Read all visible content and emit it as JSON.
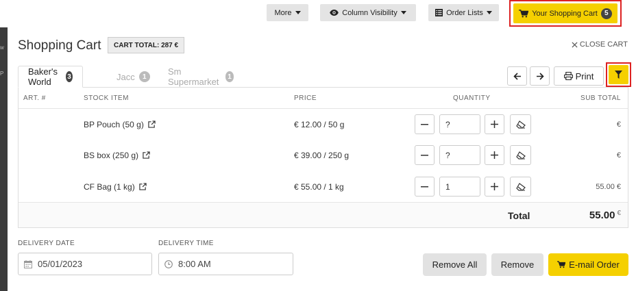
{
  "toolbar": {
    "more_label": "More",
    "column_visibility_label": "Column Visibility",
    "order_lists_label": "Order Lists",
    "cart_label": "Your Shopping Cart",
    "cart_count": "5"
  },
  "panel": {
    "title": "Shopping Cart",
    "cart_total": "CART TOTAL: 287 €",
    "close_label": "CLOSE CART"
  },
  "tabs": [
    {
      "label": "Baker's World",
      "count": "3",
      "active": true
    },
    {
      "label": "Jacc",
      "count": "1",
      "active": false
    },
    {
      "label": "Sm Supermarket",
      "count": "1",
      "active": false
    }
  ],
  "actions": {
    "print_label": "Print"
  },
  "table": {
    "headers": {
      "art": "ART. #",
      "stock_item": "STOCK ITEM",
      "price": "PRICE",
      "quantity": "QUANTITY",
      "sub_total": "SUB TOTAL"
    },
    "rows": [
      {
        "art": "",
        "item": "BP Pouch (50 g)",
        "price": "€ 12.00 / 50 g",
        "qty": "?",
        "sub": "€"
      },
      {
        "art": "",
        "item": "BS box (250 g)",
        "price": "€ 39.00 / 250 g",
        "qty": "?",
        "sub": "€"
      },
      {
        "art": "",
        "item": "CF Bag (1 kg)",
        "price": "€ 55.00 / 1 kg",
        "qty": "1",
        "sub": "55.00 €"
      }
    ],
    "total_label": "Total",
    "total_value": "55.00",
    "total_currency": "€"
  },
  "delivery": {
    "date_label": "DELIVERY DATE",
    "date_value": "05/01/2023",
    "time_label": "DELIVERY TIME",
    "time_value": "8:00 AM"
  },
  "buttons": {
    "remove_all": "Remove All",
    "remove": "Remove",
    "email_order": "E-mail Order"
  },
  "background": {
    "frag1": "w",
    "frag2": "P"
  },
  "colors": {
    "accent_yellow": "#f5d000",
    "highlight_red": "#dd2222"
  }
}
